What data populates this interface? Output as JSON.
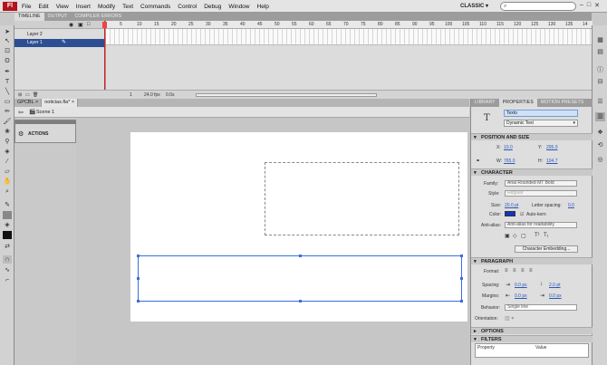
{
  "app": {
    "logo": "Fl"
  },
  "menu": [
    "File",
    "Edit",
    "View",
    "Insert",
    "Modify",
    "Text",
    "Commands",
    "Control",
    "Debug",
    "Window",
    "Help"
  ],
  "workspace": "CLASSIC",
  "window_controls": [
    "–",
    "□",
    "✕"
  ],
  "timeline": {
    "tabs": [
      "TIMELINE",
      "OUTPUT",
      "COMPILER ERRORS"
    ],
    "layers": [
      "Layer 2",
      "Layer 1"
    ],
    "ruler": [
      "5",
      "10",
      "15",
      "20",
      "25",
      "30",
      "35",
      "40",
      "45",
      "50",
      "55",
      "60",
      "65",
      "70",
      "75",
      "80",
      "85",
      "90",
      "95",
      "100",
      "105",
      "110",
      "115",
      "120",
      "125",
      "130",
      "135",
      "14"
    ],
    "status": {
      "frame": "1",
      "fps": "24.0 fps",
      "time": "0.0s"
    }
  },
  "documents": {
    "tabs": [
      "GPCBL",
      "noticias.fla*"
    ],
    "scene": "Scene 1"
  },
  "actions_panel": {
    "label": "ACTIONS"
  },
  "properties": {
    "tabs": [
      "LIBRARY",
      "PROPERTIES",
      "MOTION PRESETS"
    ],
    "instance_name": "Texto",
    "text_type": "Dynamic Text",
    "sections": {
      "position": "POSITION AND SIZE",
      "character": "CHARACTER",
      "paragraph": "PARAGRAPH",
      "options": "OPTIONS",
      "filters": "FILTERS"
    },
    "position": {
      "x_label": "X:",
      "x": "10.0",
      "y_label": "Y:",
      "y": "295.0",
      "w_label": "W:",
      "w": "765.0",
      "h_label": "H:",
      "h": "104.7"
    },
    "character": {
      "family_label": "Family:",
      "family": "Arial Rounded MT Bold",
      "style_label": "Style:",
      "style": "Regular",
      "size_label": "Size:",
      "size": "20.0 pt",
      "spacing_label": "Letter spacing:",
      "spacing": "0.0",
      "color_label": "Color:",
      "autokern": "Auto-kern",
      "aa_label": "Anti-alias:",
      "aa": "Anti-alias for readability",
      "embed_button": "Character Embedding...",
      "color": "#1234c4"
    },
    "paragraph": {
      "format_label": "Format:",
      "spacing_label": "Spacing:",
      "spacing1": "0.0 px",
      "spacing2": "2.0 pt",
      "margins_label": "Margins:",
      "margin1": "0.0 px",
      "margin2": "0.0 px",
      "behavior_label": "Behavior:",
      "behavior": "Single line",
      "orientation_label": "Orientation:"
    },
    "filters": {
      "col1": "Property",
      "col2": "Value"
    }
  }
}
